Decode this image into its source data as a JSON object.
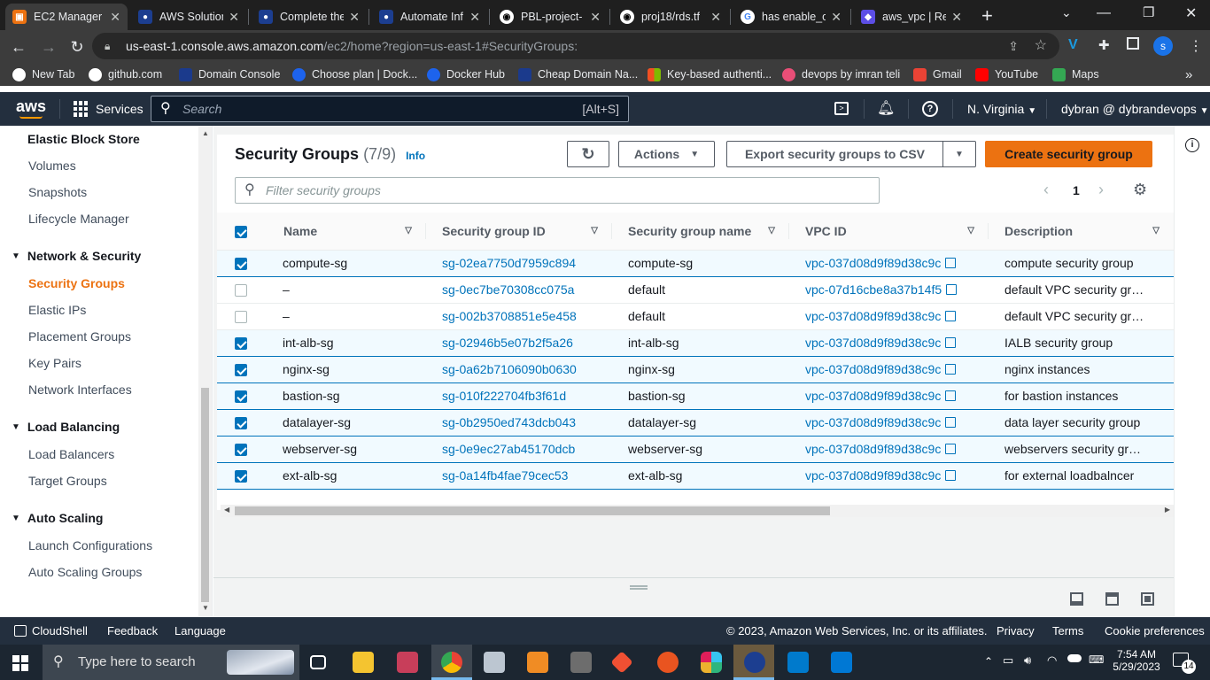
{
  "browser": {
    "tabs": [
      {
        "label": "EC2 Manager",
        "active": true
      },
      {
        "label": "AWS Solution"
      },
      {
        "label": "Complete the"
      },
      {
        "label": "Automate Inf"
      },
      {
        "label": "PBL-project-"
      },
      {
        "label": "proj18/rds.tf"
      },
      {
        "label": "has enable_cl"
      },
      {
        "label": "aws_vpc | Res"
      }
    ],
    "new_tab": "+",
    "url_host": "us-east-1.console.aws.amazon.com",
    "url_path": "/ec2/home?region=us-east-1#SecurityGroups:",
    "profile_initial": "s",
    "bookmarks": [
      "New Tab",
      "github.com",
      "Domain Console",
      "Choose plan | Dock...",
      "Docker Hub",
      "Cheap Domain Na...",
      "Key-based authenti...",
      "devops by imran teli",
      "Gmail",
      "YouTube",
      "Maps"
    ],
    "more_bookmarks": "»"
  },
  "aws_header": {
    "logo": "aws",
    "services_label": "Services",
    "search_placeholder": "Search",
    "search_shortcut": "[Alt+S]",
    "region": "N. Virginia",
    "account": "dybran @ dybrandevops"
  },
  "sidebar": {
    "sections": [
      {
        "title": "Elastic Block Store",
        "items": [
          "Volumes",
          "Snapshots",
          "Lifecycle Manager"
        ]
      },
      {
        "title": "Network & Security",
        "items": [
          "Security Groups",
          "Elastic IPs",
          "Placement Groups",
          "Key Pairs",
          "Network Interfaces"
        ]
      },
      {
        "title": "Load Balancing",
        "items": [
          "Load Balancers",
          "Target Groups"
        ]
      },
      {
        "title": "Auto Scaling",
        "items": [
          "Launch Configurations",
          "Auto Scaling Groups"
        ]
      }
    ],
    "active_item": "Security Groups"
  },
  "main": {
    "title": "Security Groups",
    "count": "(7/9)",
    "info": "Info",
    "actions_label": "Actions",
    "export_label": "Export security groups to CSV",
    "create_label": "Create security group",
    "filter_placeholder": "Filter security groups",
    "page": "1",
    "columns": [
      "Name",
      "Security group ID",
      "Security group name",
      "VPC ID",
      "Description"
    ],
    "rows": [
      {
        "selected": true,
        "name": "compute-sg",
        "id": "sg-02ea7750d7959c894",
        "group_name": "compute-sg",
        "vpc": "vpc-037d08d9f89d38c9c",
        "desc": "compute security group"
      },
      {
        "selected": false,
        "name": "–",
        "id": "sg-0ec7be70308cc075a",
        "group_name": "default",
        "vpc": "vpc-07d16cbe8a37b14f5",
        "desc": "default VPC security gr…"
      },
      {
        "selected": false,
        "name": "–",
        "id": "sg-002b3708851e5e458",
        "group_name": "default",
        "vpc": "vpc-037d08d9f89d38c9c",
        "desc": "default VPC security gr…"
      },
      {
        "selected": true,
        "name": "int-alb-sg",
        "id": "sg-02946b5e07b2f5a26",
        "group_name": "int-alb-sg",
        "vpc": "vpc-037d08d9f89d38c9c",
        "desc": "IALB security group"
      },
      {
        "selected": true,
        "name": "nginx-sg",
        "id": "sg-0a62b7106090b0630",
        "group_name": "nginx-sg",
        "vpc": "vpc-037d08d9f89d38c9c",
        "desc": "nginx instances"
      },
      {
        "selected": true,
        "name": "bastion-sg",
        "id": "sg-010f222704fb3f61d",
        "group_name": "bastion-sg",
        "vpc": "vpc-037d08d9f89d38c9c",
        "desc": "for bastion instances"
      },
      {
        "selected": true,
        "name": "datalayer-sg",
        "id": "sg-0b2950ed743dcb043",
        "group_name": "datalayer-sg",
        "vpc": "vpc-037d08d9f89d38c9c",
        "desc": "data layer security group"
      },
      {
        "selected": true,
        "name": "webserver-sg",
        "id": "sg-0e9ec27ab45170dcb",
        "group_name": "webserver-sg",
        "vpc": "vpc-037d08d9f89d38c9c",
        "desc": "webservers security gr…"
      },
      {
        "selected": true,
        "name": "ext-alb-sg",
        "id": "sg-0a14fb4fae79cec53",
        "group_name": "ext-alb-sg",
        "vpc": "vpc-037d08d9f89d38c9c",
        "desc": "for external loadbalncer"
      }
    ]
  },
  "footer": {
    "cloudshell": "CloudShell",
    "feedback": "Feedback",
    "language": "Language",
    "copyright": "© 2023, Amazon Web Services, Inc. or its affiliates.",
    "privacy": "Privacy",
    "terms": "Terms",
    "cookies": "Cookie preferences"
  },
  "taskbar": {
    "search_placeholder": "Type here to search",
    "time": "7:54 AM",
    "date": "5/29/2023",
    "notifications": "14"
  },
  "colors": {
    "aws_orange": "#ec7211",
    "aws_dark": "#232f3e",
    "link_blue": "#0073bb"
  }
}
